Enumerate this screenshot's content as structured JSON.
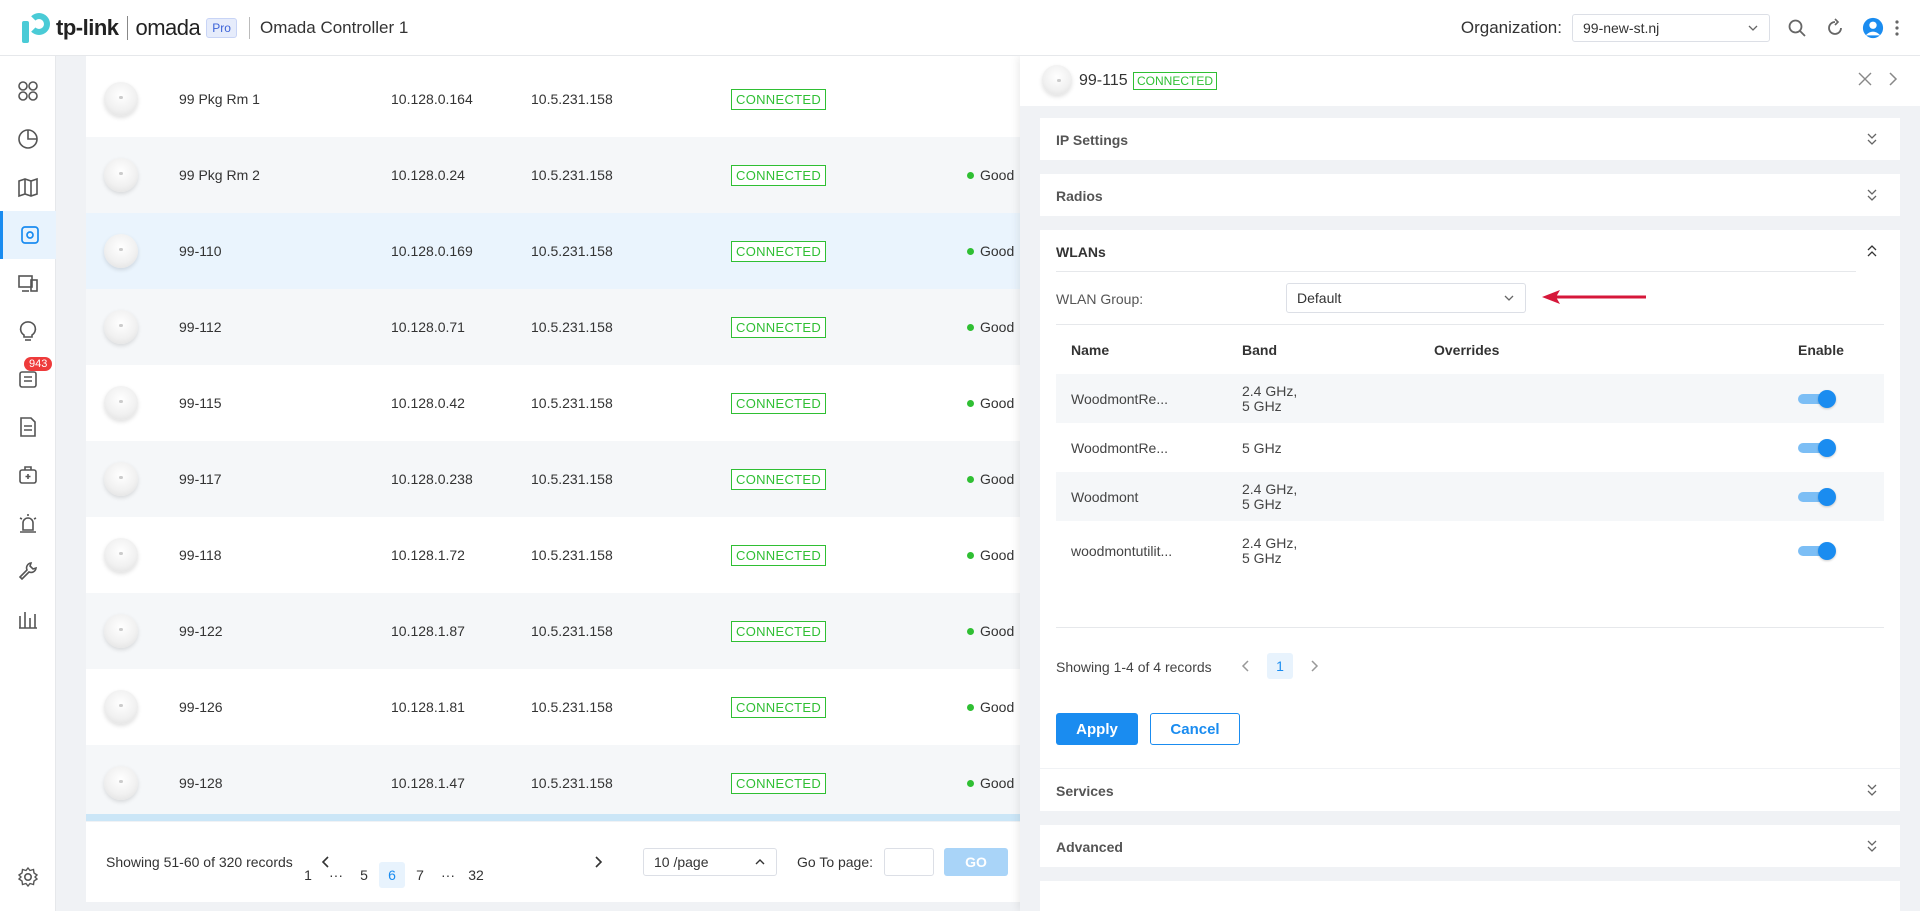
{
  "header": {
    "brand": "tp-link",
    "product": "omada",
    "edition": "Pro",
    "controller": "Omada Controller 1",
    "org_label": "Organization:",
    "org_value": "99-new-st.nj"
  },
  "sidebar": {
    "items": [
      "dashboard",
      "statistics",
      "map",
      "devices",
      "clients",
      "insights",
      "logs",
      "reports",
      "tools",
      "alerts",
      "maintenance",
      "analytics"
    ],
    "badge": "943",
    "settings": "settings"
  },
  "devices": {
    "rows": [
      {
        "name": "99 Pkg Rm 1",
        "ip": "10.128.0.164",
        "public_ip": "10.5.231.158",
        "status": "CONNECTED",
        "health": ""
      },
      {
        "name": "99 Pkg Rm 2",
        "ip": "10.128.0.24",
        "public_ip": "10.5.231.158",
        "status": "CONNECTED",
        "health": "Good"
      },
      {
        "name": "99-110",
        "ip": "10.128.0.169",
        "public_ip": "10.5.231.158",
        "status": "CONNECTED",
        "health": "Good"
      },
      {
        "name": "99-112",
        "ip": "10.128.0.71",
        "public_ip": "10.5.231.158",
        "status": "CONNECTED",
        "health": "Good"
      },
      {
        "name": "99-115",
        "ip": "10.128.0.42",
        "public_ip": "10.5.231.158",
        "status": "CONNECTED",
        "health": "Good"
      },
      {
        "name": "99-117",
        "ip": "10.128.0.238",
        "public_ip": "10.5.231.158",
        "status": "CONNECTED",
        "health": "Good"
      },
      {
        "name": "99-118",
        "ip": "10.128.1.72",
        "public_ip": "10.5.231.158",
        "status": "CONNECTED",
        "health": "Good"
      },
      {
        "name": "99-122",
        "ip": "10.128.1.87",
        "public_ip": "10.5.231.158",
        "status": "CONNECTED",
        "health": "Good"
      },
      {
        "name": "99-126",
        "ip": "10.128.1.81",
        "public_ip": "10.5.231.158",
        "status": "CONNECTED",
        "health": "Good"
      },
      {
        "name": "99-128",
        "ip": "10.128.1.47",
        "public_ip": "10.5.231.158",
        "status": "CONNECTED",
        "health": "Good"
      }
    ],
    "pagination": {
      "info": "Showing 51-60 of 320 records",
      "pages": [
        "1",
        "···",
        "5",
        "6",
        "7",
        "···",
        "32"
      ],
      "current": "6",
      "page_size": "10 /page",
      "goto_label": "Go To page:",
      "go": "GO"
    }
  },
  "panel": {
    "device_name": "99-115",
    "status": "CONNECTED",
    "sections": {
      "ip_settings": "IP Settings",
      "radios": "Radios",
      "wlans": "WLANs",
      "services": "Services",
      "advanced": "Advanced"
    },
    "wlan_group_label": "WLAN Group:",
    "wlan_group_value": "Default",
    "wlan_table": {
      "headers": {
        "name": "Name",
        "band": "Band",
        "overrides": "Overrides",
        "enable": "Enable"
      },
      "rows": [
        {
          "name": "WoodmontRe...",
          "band1": "2.4 GHz,",
          "band2": "5 GHz",
          "enabled": true
        },
        {
          "name": "WoodmontRe...",
          "band1": "5 GHz",
          "band2": "",
          "enabled": true
        },
        {
          "name": "Woodmont",
          "band1": "2.4 GHz,",
          "band2": "5 GHz",
          "enabled": true
        },
        {
          "name": "woodmontutilit...",
          "band1": "2.4 GHz,",
          "band2": "5 GHz",
          "enabled": true
        }
      ],
      "info": "Showing 1-4 of 4 records",
      "page": "1"
    },
    "apply": "Apply",
    "cancel": "Cancel"
  },
  "colors": {
    "accent": "#1a8cf0",
    "connected": "#2fbf33",
    "annotation_arrow": "#d6173a",
    "badge": "#ee3b3b"
  }
}
